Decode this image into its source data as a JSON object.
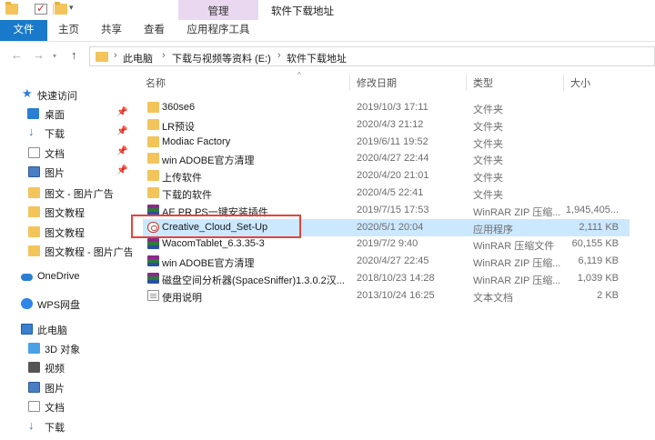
{
  "title_bar": {
    "manage_label": "管理",
    "window_title": "软件下载地址"
  },
  "ribbon": {
    "tabs": [
      "文件",
      "主页",
      "共享",
      "查看"
    ],
    "contextual_tab": "应用程序工具"
  },
  "address_bar": {
    "crumbs": [
      "此电脑",
      "下载与视频等资料 (E:)",
      "软件下载地址"
    ]
  },
  "sidebar": {
    "quick_access": "快速访问",
    "items": [
      {
        "label": "桌面",
        "pinned": true
      },
      {
        "label": "下载",
        "pinned": true
      },
      {
        "label": "文档",
        "pinned": true
      },
      {
        "label": "图片",
        "pinned": true
      },
      {
        "label": "图文 - 图片广告",
        "pinned": false
      },
      {
        "label": "图文教程",
        "pinned": false
      },
      {
        "label": "图文教程",
        "pinned": false
      },
      {
        "label": "图文教程 - 图片广告",
        "pinned": false
      }
    ],
    "onedrive": "OneDrive",
    "wps": "WPS网盘",
    "this_pc": "此电脑",
    "pc_items": [
      "3D 对象",
      "视频",
      "图片",
      "文档",
      "下载"
    ]
  },
  "columns": {
    "name": "名称",
    "date": "修改日期",
    "type": "类型",
    "size": "大小"
  },
  "files": [
    {
      "name": "360se6",
      "date": "2019/10/3 17:11",
      "type": "文件夹",
      "size": "",
      "icon": "folder-icon"
    },
    {
      "name": "LR预设",
      "date": "2020/4/3 21:12",
      "type": "文件夹",
      "size": "",
      "icon": "folder-icon"
    },
    {
      "name": "Modiac Factory",
      "date": "2019/6/11 19:52",
      "type": "文件夹",
      "size": "",
      "icon": "folder-icon"
    },
    {
      "name": "win ADOBE官方清理",
      "date": "2020/4/27 22:44",
      "type": "文件夹",
      "size": "",
      "icon": "folder-icon"
    },
    {
      "name": "上传软件",
      "date": "2020/4/20 21:01",
      "type": "文件夹",
      "size": "",
      "icon": "folder-icon"
    },
    {
      "name": "下载的软件",
      "date": "2020/4/5 22:41",
      "type": "文件夹",
      "size": "",
      "icon": "folder-icon"
    },
    {
      "name": "AE PR PS一键安装插件",
      "date": "2019/7/15 17:53",
      "type": "WinRAR ZIP 压缩...",
      "size": "1,945,405...",
      "icon": "winrar-icon"
    },
    {
      "name": "Creative_Cloud_Set-Up",
      "date": "2020/5/1 20:04",
      "type": "应用程序",
      "size": "2,111 KB",
      "icon": "creative-cloud-icon",
      "selected": true
    },
    {
      "name": "WacomTablet_6.3.35-3",
      "date": "2019/7/2 9:40",
      "type": "WinRAR 压缩文件",
      "size": "60,155 KB",
      "icon": "winrar-icon"
    },
    {
      "name": "win ADOBE官方清理",
      "date": "2020/4/27 22:45",
      "type": "WinRAR ZIP 压缩...",
      "size": "6,119 KB",
      "icon": "winrar-icon"
    },
    {
      "name": "磁盘空间分析器(SpaceSniffer)1.3.0.2汉...",
      "date": "2018/10/23 14:28",
      "type": "WinRAR ZIP 压缩...",
      "size": "1,039 KB",
      "icon": "winrar-icon"
    },
    {
      "name": "使用说明",
      "date": "2013/10/24 16:25",
      "type": "文本文档",
      "size": "2 KB",
      "icon": "text-file-icon"
    }
  ]
}
